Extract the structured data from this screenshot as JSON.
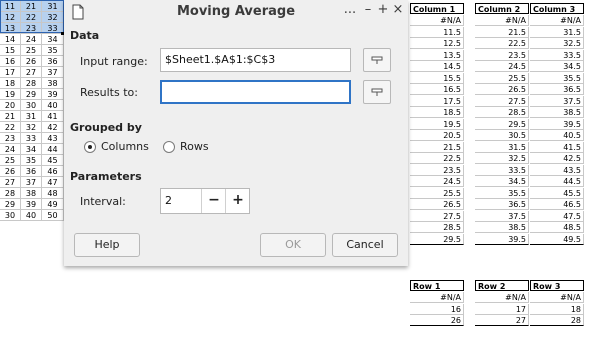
{
  "left_sheet": {
    "rows": [
      [
        "11",
        "21",
        "31"
      ],
      [
        "12",
        "22",
        "32"
      ],
      [
        "13",
        "23",
        "33"
      ],
      [
        "14",
        "24",
        "34"
      ],
      [
        "15",
        "25",
        "35"
      ],
      [
        "16",
        "26",
        "36"
      ],
      [
        "17",
        "27",
        "37"
      ],
      [
        "18",
        "28",
        "38"
      ],
      [
        "19",
        "29",
        "39"
      ],
      [
        "20",
        "30",
        "40"
      ],
      [
        "21",
        "31",
        "41"
      ],
      [
        "22",
        "32",
        "42"
      ],
      [
        "23",
        "33",
        "43"
      ],
      [
        "24",
        "34",
        "44"
      ],
      [
        "25",
        "35",
        "45"
      ],
      [
        "26",
        "36",
        "46"
      ],
      [
        "27",
        "37",
        "47"
      ],
      [
        "28",
        "38",
        "48"
      ],
      [
        "29",
        "39",
        "49"
      ],
      [
        "30",
        "40",
        "50"
      ]
    ]
  },
  "right_sheet": {
    "cols_headers": [
      "Column 1",
      "Column 2",
      "Column 3"
    ],
    "cols_rows": [
      [
        "#N/A",
        "#N/A",
        "#N/A"
      ],
      [
        "11.5",
        "21.5",
        "31.5"
      ],
      [
        "12.5",
        "22.5",
        "32.5"
      ],
      [
        "13.5",
        "23.5",
        "33.5"
      ],
      [
        "14.5",
        "24.5",
        "34.5"
      ],
      [
        "15.5",
        "25.5",
        "35.5"
      ],
      [
        "16.5",
        "26.5",
        "36.5"
      ],
      [
        "17.5",
        "27.5",
        "37.5"
      ],
      [
        "18.5",
        "28.5",
        "38.5"
      ],
      [
        "19.5",
        "29.5",
        "39.5"
      ],
      [
        "20.5",
        "30.5",
        "40.5"
      ],
      [
        "21.5",
        "31.5",
        "41.5"
      ],
      [
        "22.5",
        "32.5",
        "42.5"
      ],
      [
        "23.5",
        "33.5",
        "43.5"
      ],
      [
        "24.5",
        "34.5",
        "44.5"
      ],
      [
        "25.5",
        "35.5",
        "45.5"
      ],
      [
        "26.5",
        "36.5",
        "46.5"
      ],
      [
        "27.5",
        "37.5",
        "47.5"
      ],
      [
        "28.5",
        "38.5",
        "48.5"
      ],
      [
        "29.5",
        "39.5",
        "49.5"
      ]
    ],
    "rows_headers": [
      "Row 1",
      "Row 2",
      "Row 3"
    ],
    "rows_rows": [
      [
        "#N/A",
        "#N/A",
        "#N/A"
      ],
      [
        "16",
        "17",
        "18"
      ],
      [
        "26",
        "27",
        "28"
      ]
    ]
  },
  "dialog": {
    "title": "Moving Average",
    "title_buttons": [
      "...",
      "–",
      "+",
      "×"
    ],
    "data_section": "Data",
    "input_range_label": "Input range:",
    "input_range_value": "$Sheet1.$A$1:$C$3",
    "results_to_label": "Results to:",
    "results_to_value": "",
    "grouped_by_section": "Grouped by",
    "columns_label": "Columns",
    "rows_label": "Rows",
    "parameters_section": "Parameters",
    "interval_label": "Interval:",
    "interval_value": "2",
    "minus": "−",
    "plus": "+",
    "help_button": "Help",
    "ok_button": "OK",
    "cancel_button": "Cancel"
  }
}
